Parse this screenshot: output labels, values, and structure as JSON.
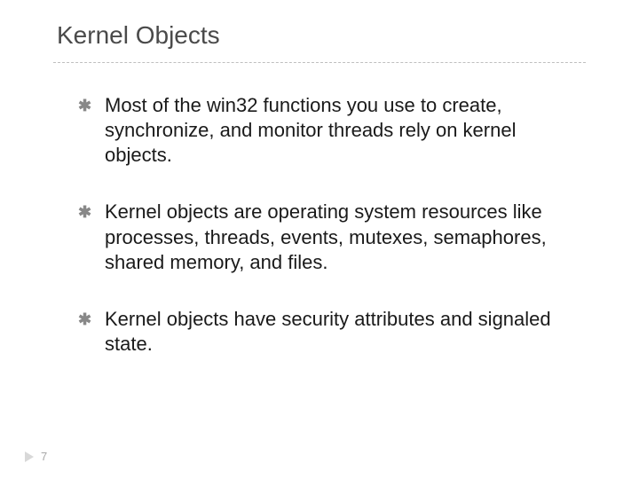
{
  "slide": {
    "title": "Kernel Objects",
    "bullets": [
      "Most of the win32 functions you use to create, synchronize, and monitor threads rely on kernel objects.",
      "Kernel objects are operating system resources like processes, threads, events, mutexes, semaphores, shared memory, and files.",
      "Kernel objects have security attributes and signaled state."
    ],
    "page_number": "7"
  }
}
